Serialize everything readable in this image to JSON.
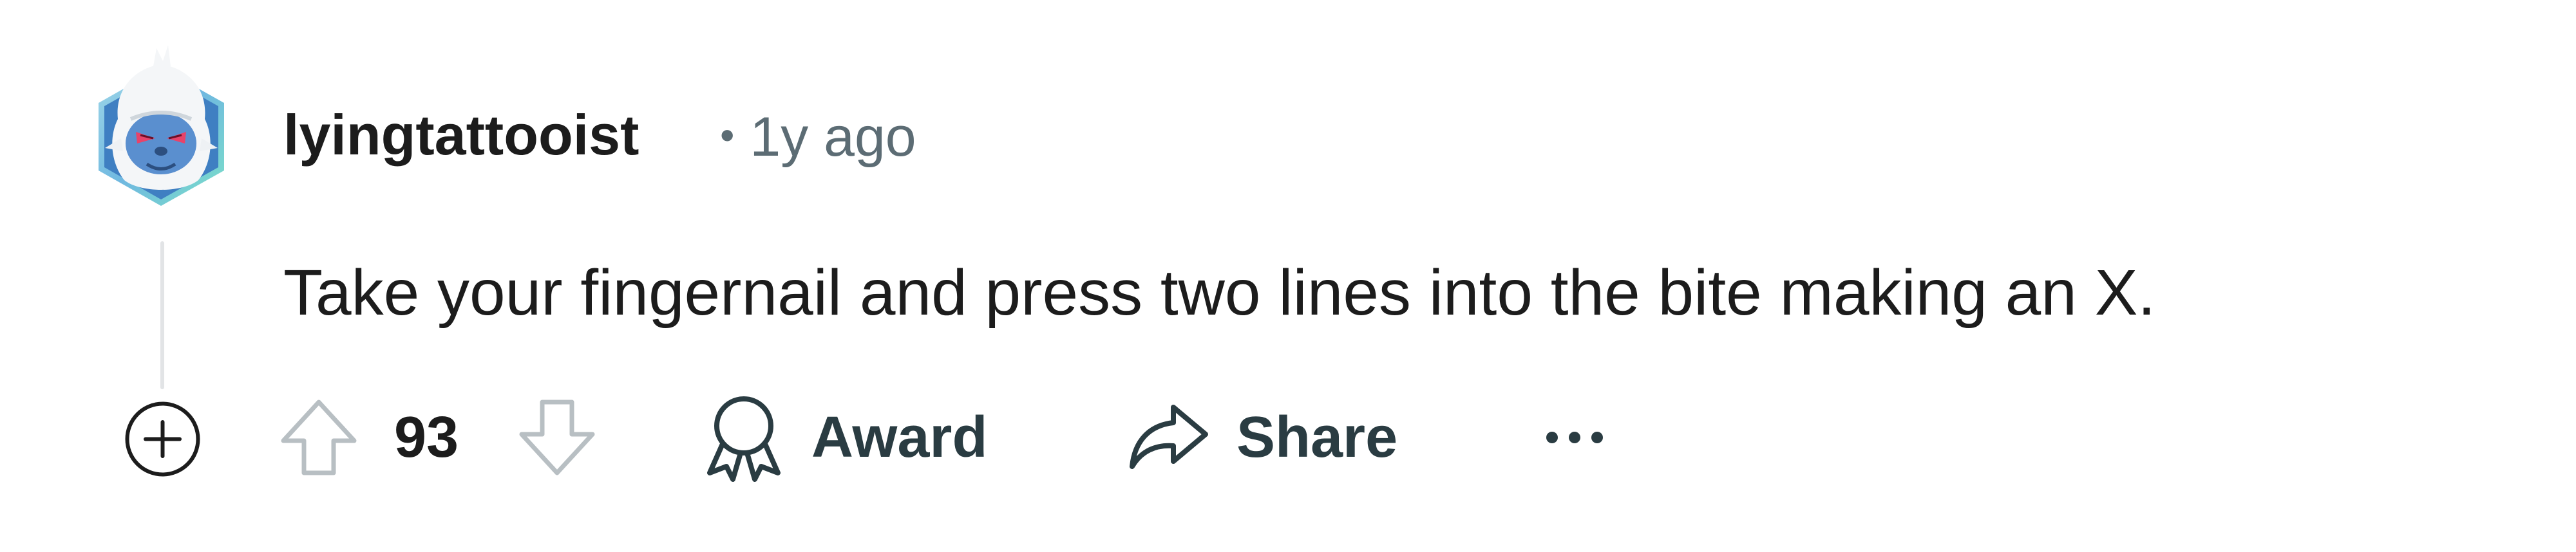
{
  "comment": {
    "author": "lyingtattooist",
    "age": "1y ago",
    "separator": "•",
    "body": "Take your fingernail and press two lines into the bite making an X.",
    "score": "93",
    "avatar_icon": "yeti-avatar-icon"
  },
  "actions": {
    "expand_icon": "plus-circle-icon",
    "upvote_icon": "arrow-up-icon",
    "downvote_icon": "arrow-down-icon",
    "award_label": "Award",
    "award_icon": "award-ribbon-icon",
    "share_label": "Share",
    "share_icon": "share-arrow-icon",
    "more_icon": "ellipsis-icon"
  },
  "colors": {
    "text": "#1c1c1c",
    "meta": "#5c6c74",
    "action_text": "#2a3c42",
    "icon_muted": "#b8bfc3",
    "thread_line": "#e2e4e6"
  }
}
